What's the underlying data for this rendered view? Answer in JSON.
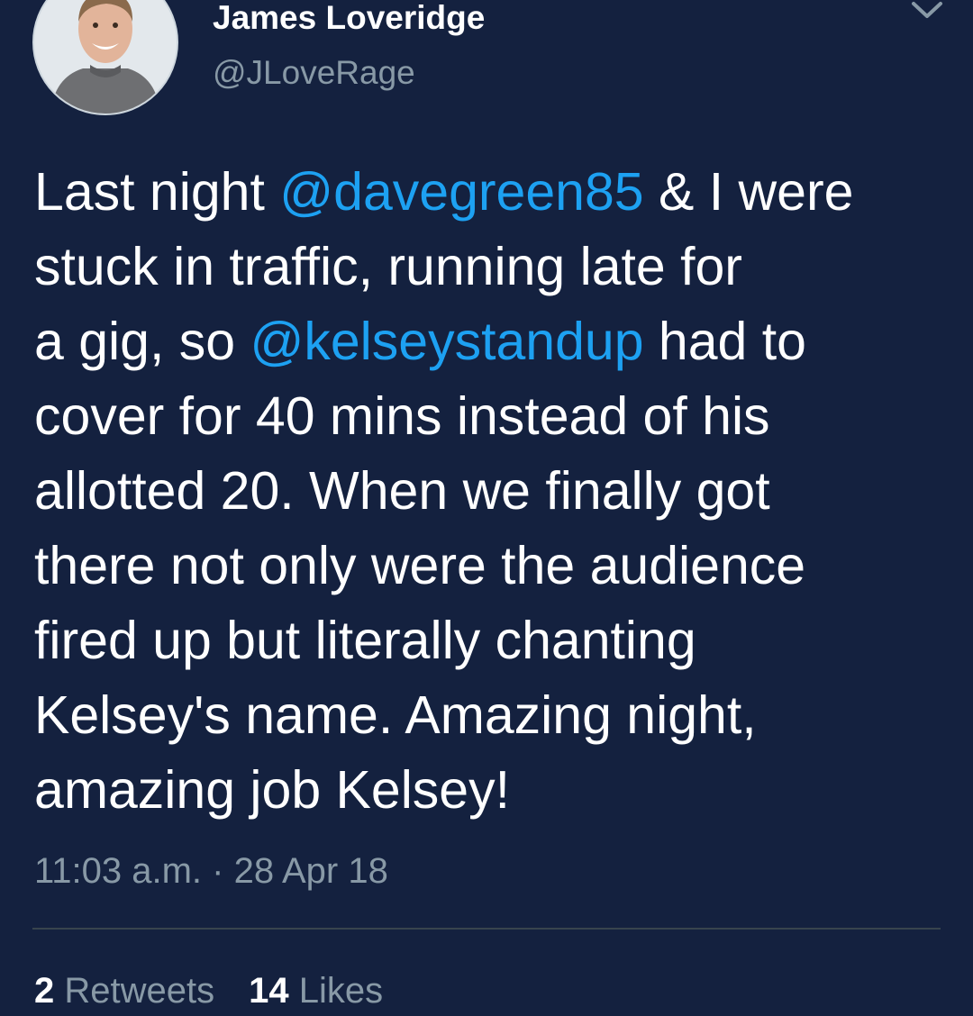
{
  "author": {
    "name": "James Loveridge",
    "handle": "@JLoveRage"
  },
  "icons": {
    "avatar": "profile-photo",
    "menu": "chevron-down-icon"
  },
  "tweet": {
    "lines": [
      [
        {
          "t": "Last night "
        },
        {
          "t": "@davegreen85",
          "mention": true
        },
        {
          "t": " & I were"
        }
      ],
      [
        {
          "t": "stuck in traffic, running late for"
        }
      ],
      [
        {
          "t": "a gig, so "
        },
        {
          "t": "@kelseystandup",
          "mention": true
        },
        {
          "t": " had to"
        }
      ],
      [
        {
          "t": "cover for 40 mins instead of his"
        }
      ],
      [
        {
          "t": "allotted 20. When we finally got"
        }
      ],
      [
        {
          "t": "there not only were the audience"
        }
      ],
      [
        {
          "t": "fired up but literally chanting"
        }
      ],
      [
        {
          "t": "Kelsey's name. Amazing night,"
        }
      ],
      [
        {
          "t": "amazing job Kelsey!"
        }
      ]
    ]
  },
  "meta": {
    "time": "11:03 a.m.",
    "separator": " · ",
    "date": "28 Apr 18"
  },
  "stats": {
    "retweets_count": "2",
    "retweets_label": "Retweets",
    "likes_count": "14",
    "likes_label": "Likes"
  },
  "colors": {
    "background": "#14213f",
    "mention": "#1da1f2",
    "secondary_text": "#8899a6",
    "divider": "#38444d"
  }
}
